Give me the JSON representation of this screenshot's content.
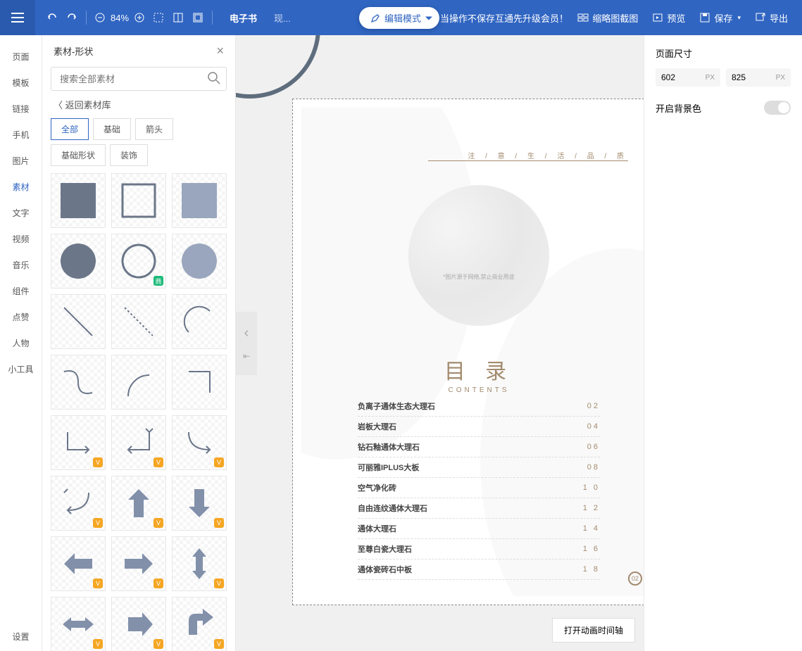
{
  "topbar": {
    "zoom": "84%",
    "mode_active": "电子书",
    "mode_other": "现...",
    "edit_mode": "编辑模式",
    "banner": "当操作不保存互通先升级会员！",
    "thumbnail": "缩略图截图",
    "preview": "预览",
    "save": "保存",
    "export": "导出"
  },
  "sidebar": {
    "items": [
      "页面",
      "模板",
      "链接",
      "手机",
      "图片",
      "素材",
      "文字",
      "视频",
      "音乐",
      "组件",
      "点赞",
      "人物",
      "小工具"
    ],
    "settings": "设置"
  },
  "panel": {
    "title": "素材-形状",
    "search_placeholder": "搜索全部素材",
    "back": "返回素材库",
    "tabs": [
      "全部",
      "基础",
      "箭头",
      "基础形状",
      "装饰"
    ]
  },
  "canvas": {
    "tagline": "注 / 意 / 生 / 活 / 品 / 质",
    "marble_note": "*图片源于网络,禁止商业用途",
    "contents_title": "目 录",
    "contents_sub": "CONTENTS",
    "toc": [
      {
        "name": "负离子通体生态大理石",
        "num": "02"
      },
      {
        "name": "岩板大理石",
        "num": "04"
      },
      {
        "name": "钻石釉通体大理石",
        "num": "06"
      },
      {
        "name": "可丽雅IPLUS大板",
        "num": "08"
      },
      {
        "name": "空气净化砖",
        "num": "1 0"
      },
      {
        "name": "自由连纹通体大理石",
        "num": "1 2"
      },
      {
        "name": "通体大理石",
        "num": "1 4"
      },
      {
        "name": "至尊白瓷大理石",
        "num": "1 6"
      },
      {
        "name": "通体瓷砖石中板",
        "num": "1 8"
      }
    ],
    "page_number": "02",
    "timeline_btn": "打开动画时间轴"
  },
  "right": {
    "size_title": "页面尺寸",
    "width": "602",
    "height": "825",
    "px": "PX",
    "bg_toggle": "开启背景色"
  }
}
